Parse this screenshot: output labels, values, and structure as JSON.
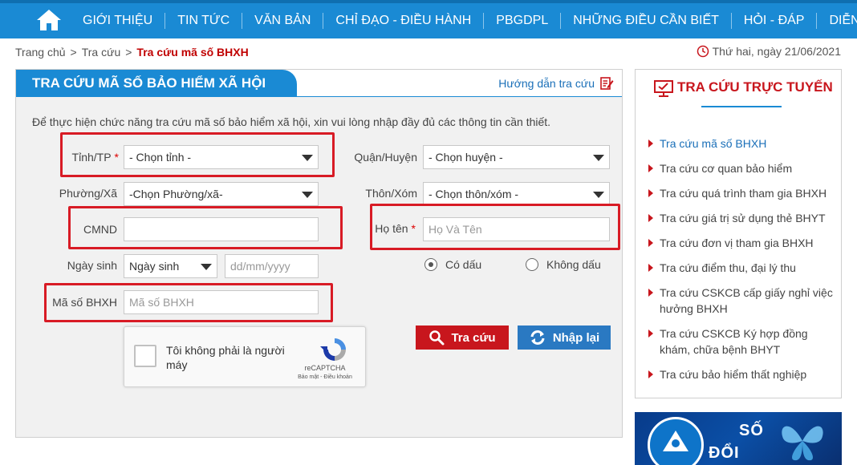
{
  "nav": {
    "items": [
      "GIỚI THIỆU",
      "TIN TỨC",
      "VĂN BẢN",
      "CHỈ ĐẠO - ĐIỀU HÀNH",
      "PBGDPL",
      "NHỮNG ĐIỀU CẦN BIẾT",
      "HỎI - ĐÁP",
      "DIỄN ĐÀN"
    ]
  },
  "breadcrumb": {
    "home": "Trang chủ",
    "lookup": "Tra cứu",
    "sep": ">",
    "current": "Tra cứu mã số BHXH"
  },
  "date": "Thứ hai, ngày 21/06/2021",
  "panel": {
    "title": "TRA CỨU MÃ SỐ BẢO HIỂM XÃ HỘI",
    "guide": "Hướng dẫn tra cứu",
    "intro": "Để thực hiện chức năng tra cứu mã số bảo hiểm xã hội, xin vui lòng nhập đầy đủ các thông tin cần thiết."
  },
  "form": {
    "province_label": "Tỉnh/TP",
    "required_mark": "*",
    "province_value": "- Chọn tỉnh -",
    "district_label": "Quận/Huyện",
    "district_value": "- Chọn huyện -",
    "ward_label": "Phường/Xã",
    "ward_value": "-Chọn Phường/xã-",
    "hamlet_label": "Thôn/Xóm",
    "hamlet_value": "- Chọn thôn/xóm -",
    "id_label": "CMND",
    "id_value": "",
    "name_label": "Họ tên",
    "name_placeholder": "Họ Và Tên",
    "dob_label": "Ngày sinh",
    "dob_type_value": "Ngày sinh",
    "dob_placeholder": "dd/mm/yyyy",
    "radio_accent": "Có dấu",
    "radio_no_accent": "Không dấu",
    "code_label": "Mã số BHXH",
    "code_placeholder": "Mã số BHXH"
  },
  "captcha": {
    "text": "Tôi không phải là người máy",
    "brand": "reCAPTCHA",
    "links": "Bảo mật - Điều khoản"
  },
  "buttons": {
    "search": "Tra cứu",
    "reset": "Nhập lại"
  },
  "sidebar": {
    "title": "TRA CỨU TRỰC TUYẾN",
    "items": [
      "Tra cứu mã số BHXH",
      "Tra cứu cơ quan bảo hiểm",
      "Tra cứu quá trình tham gia BHXH",
      "Tra cứu giá trị sử dụng thẻ BHYT",
      "Tra cứu đơn vị tham gia BHXH",
      "Tra cứu điểm thu, đại lý thu",
      "Tra cứu CSKCB cấp giấy nghỉ việc hưởng BHXH",
      "Tra cứu CSKCB Ký hợp đồng khám, chữa bệnh BHYT",
      "Tra cứu bảo hiểm thất nghiệp"
    ]
  },
  "banner": {
    "line1": "SỐ",
    "line2": "ĐỔI"
  },
  "colors": {
    "nav_blue": "#1a8ad4",
    "accent_red": "#c8161d",
    "highlight_red": "#d81b25",
    "button_blue": "#2a79c2"
  }
}
